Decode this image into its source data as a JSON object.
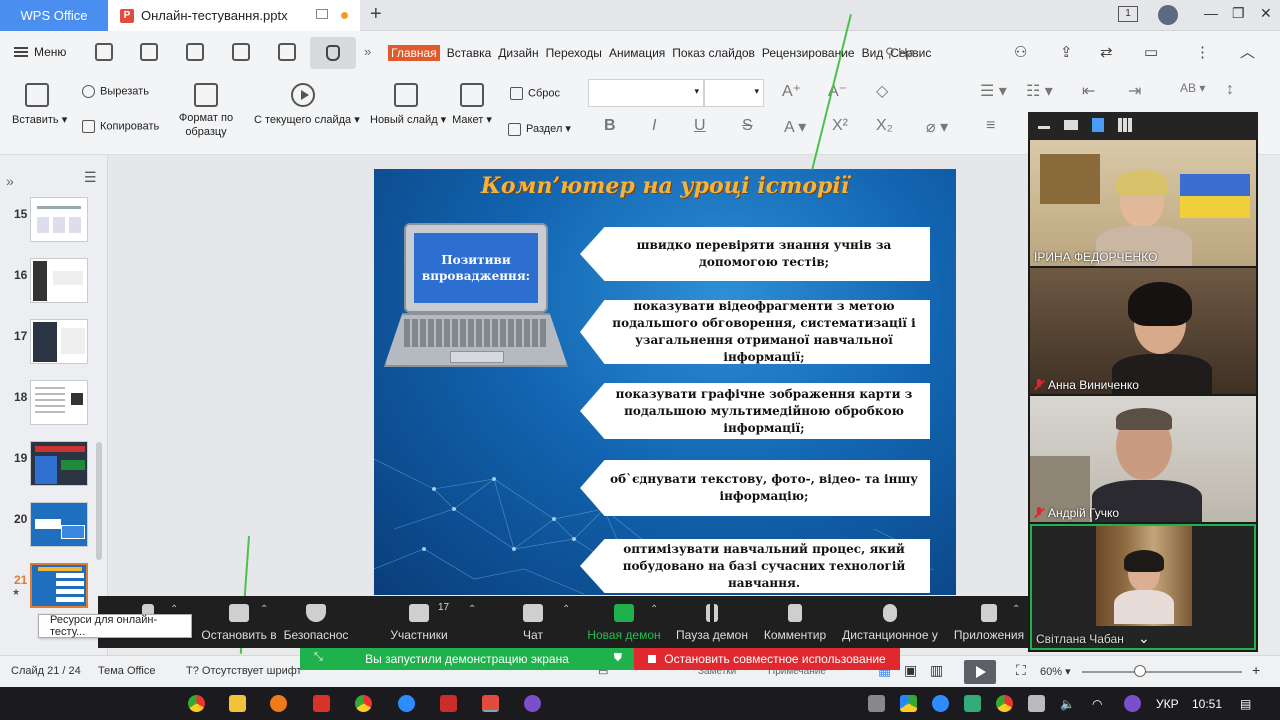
{
  "titlebar": {
    "app_tab": "WPS Office",
    "doc_tab": "Онлайн-тестування.pptx",
    "sign_in_badge": "1"
  },
  "menubar": {
    "menu_label": "Меню",
    "tabs": [
      "Главная",
      "Вставка",
      "Дизайн",
      "Переходы",
      "Анимация",
      "Показ слайдов",
      "Рецензирование",
      "Вид",
      "Сервис"
    ],
    "search_label": "На"
  },
  "ribbon": {
    "paste": "Вставить",
    "cut": "Вырезать",
    "copy": "Копировать",
    "format_painter_l1": "Формат по",
    "format_painter_l2": "образцу",
    "from_current": "С текущего слайда",
    "new_slide": "Новый слайд",
    "layout": "Макет",
    "reset": "Сброс",
    "section": "Раздел"
  },
  "slides_panel": {
    "items": [
      {
        "num": "15"
      },
      {
        "num": "16"
      },
      {
        "num": "17"
      },
      {
        "num": "18"
      },
      {
        "num": "19"
      },
      {
        "num": "20"
      },
      {
        "num": "21"
      }
    ],
    "tooltip": "Ресурси для онлайн-тесту..."
  },
  "slide": {
    "title": "Комп’ютер на уроці історії",
    "laptop_text_l1": "Позитиви",
    "laptop_text_l2": "впровадження:",
    "bullets": [
      "швидко перевіряти знання учнів за допомогою тестів;",
      "показувати відеофрагменти з метою подальшого обговорення, систематизації і узагальнення отриманої навчальної інформації;",
      "показувати графічне зображення карти з подальшою мультимедійною обробкою інформації;",
      "об`єднувати текстову, фото-, відео- та іншу інформацію;",
      "оптимізувати навчальний процес, який побудовано на базі сучасних технологій навчання."
    ]
  },
  "zoom_panel": {
    "participants": [
      {
        "name": "ІРИНА ФЕДОРЧЕНКО",
        "muted": false
      },
      {
        "name": "Анна Виниченко",
        "muted": true
      },
      {
        "name": "Андрій Гучко",
        "muted": true
      },
      {
        "name": "Світлана Чабан",
        "muted": false
      }
    ]
  },
  "zoom_bar": {
    "stop_video": "Остановить в",
    "security": "Безопаснос",
    "participants": "Участники",
    "participants_count": "17",
    "chat": "Чат",
    "new_share": "Новая демон",
    "pause_share": "Пауза демон",
    "annotate": "Комментир",
    "remote_control": "Дистанционное у",
    "apps": "Приложения",
    "sharing_notice": "Вы запустили демонстрацию экрана",
    "stop_sharing": "Остановить совместное использование"
  },
  "statusbar": {
    "slide_counter": "Слайд 21 / 24",
    "theme": "Тема Office",
    "missing_font": "Отсутствует шрифт",
    "notes": "Заметки",
    "comment": "Примечание",
    "zoom_level": "60%"
  },
  "taskbar": {
    "lang": "УКР",
    "time": "10:51"
  },
  "colors": {
    "accent_wps": "#4a8ff0",
    "active_tab": "#e05a2b",
    "share_green": "#1fb14b",
    "stop_red": "#e0282e",
    "slide_title": "#f2b43a"
  }
}
